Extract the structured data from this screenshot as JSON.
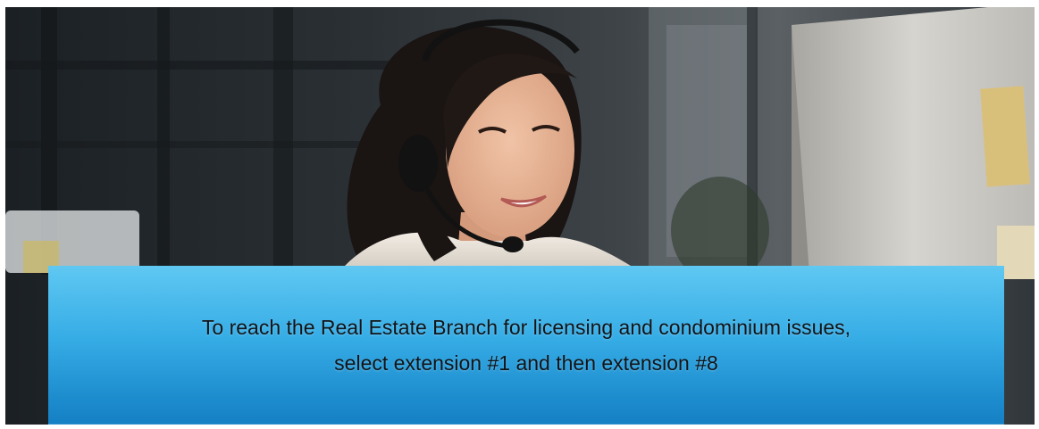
{
  "banner": {
    "photo": {
      "icon": "support-agent-photo",
      "colors": {
        "background_dark": "#1d2226",
        "monitor": "#c9c7c2",
        "sticky_note": "#d9c07a",
        "skin": "#e9b596",
        "hair": "#1a1412",
        "headset": "#121212"
      }
    },
    "caption": {
      "line1": "To reach the Real Estate Branch for licensing and condominium issues,",
      "line2": "select extension #1 and then extension #8",
      "colors": {
        "box_top": "#5fc8f2",
        "box_bottom": "#1580c4",
        "text": "#111418"
      }
    }
  }
}
